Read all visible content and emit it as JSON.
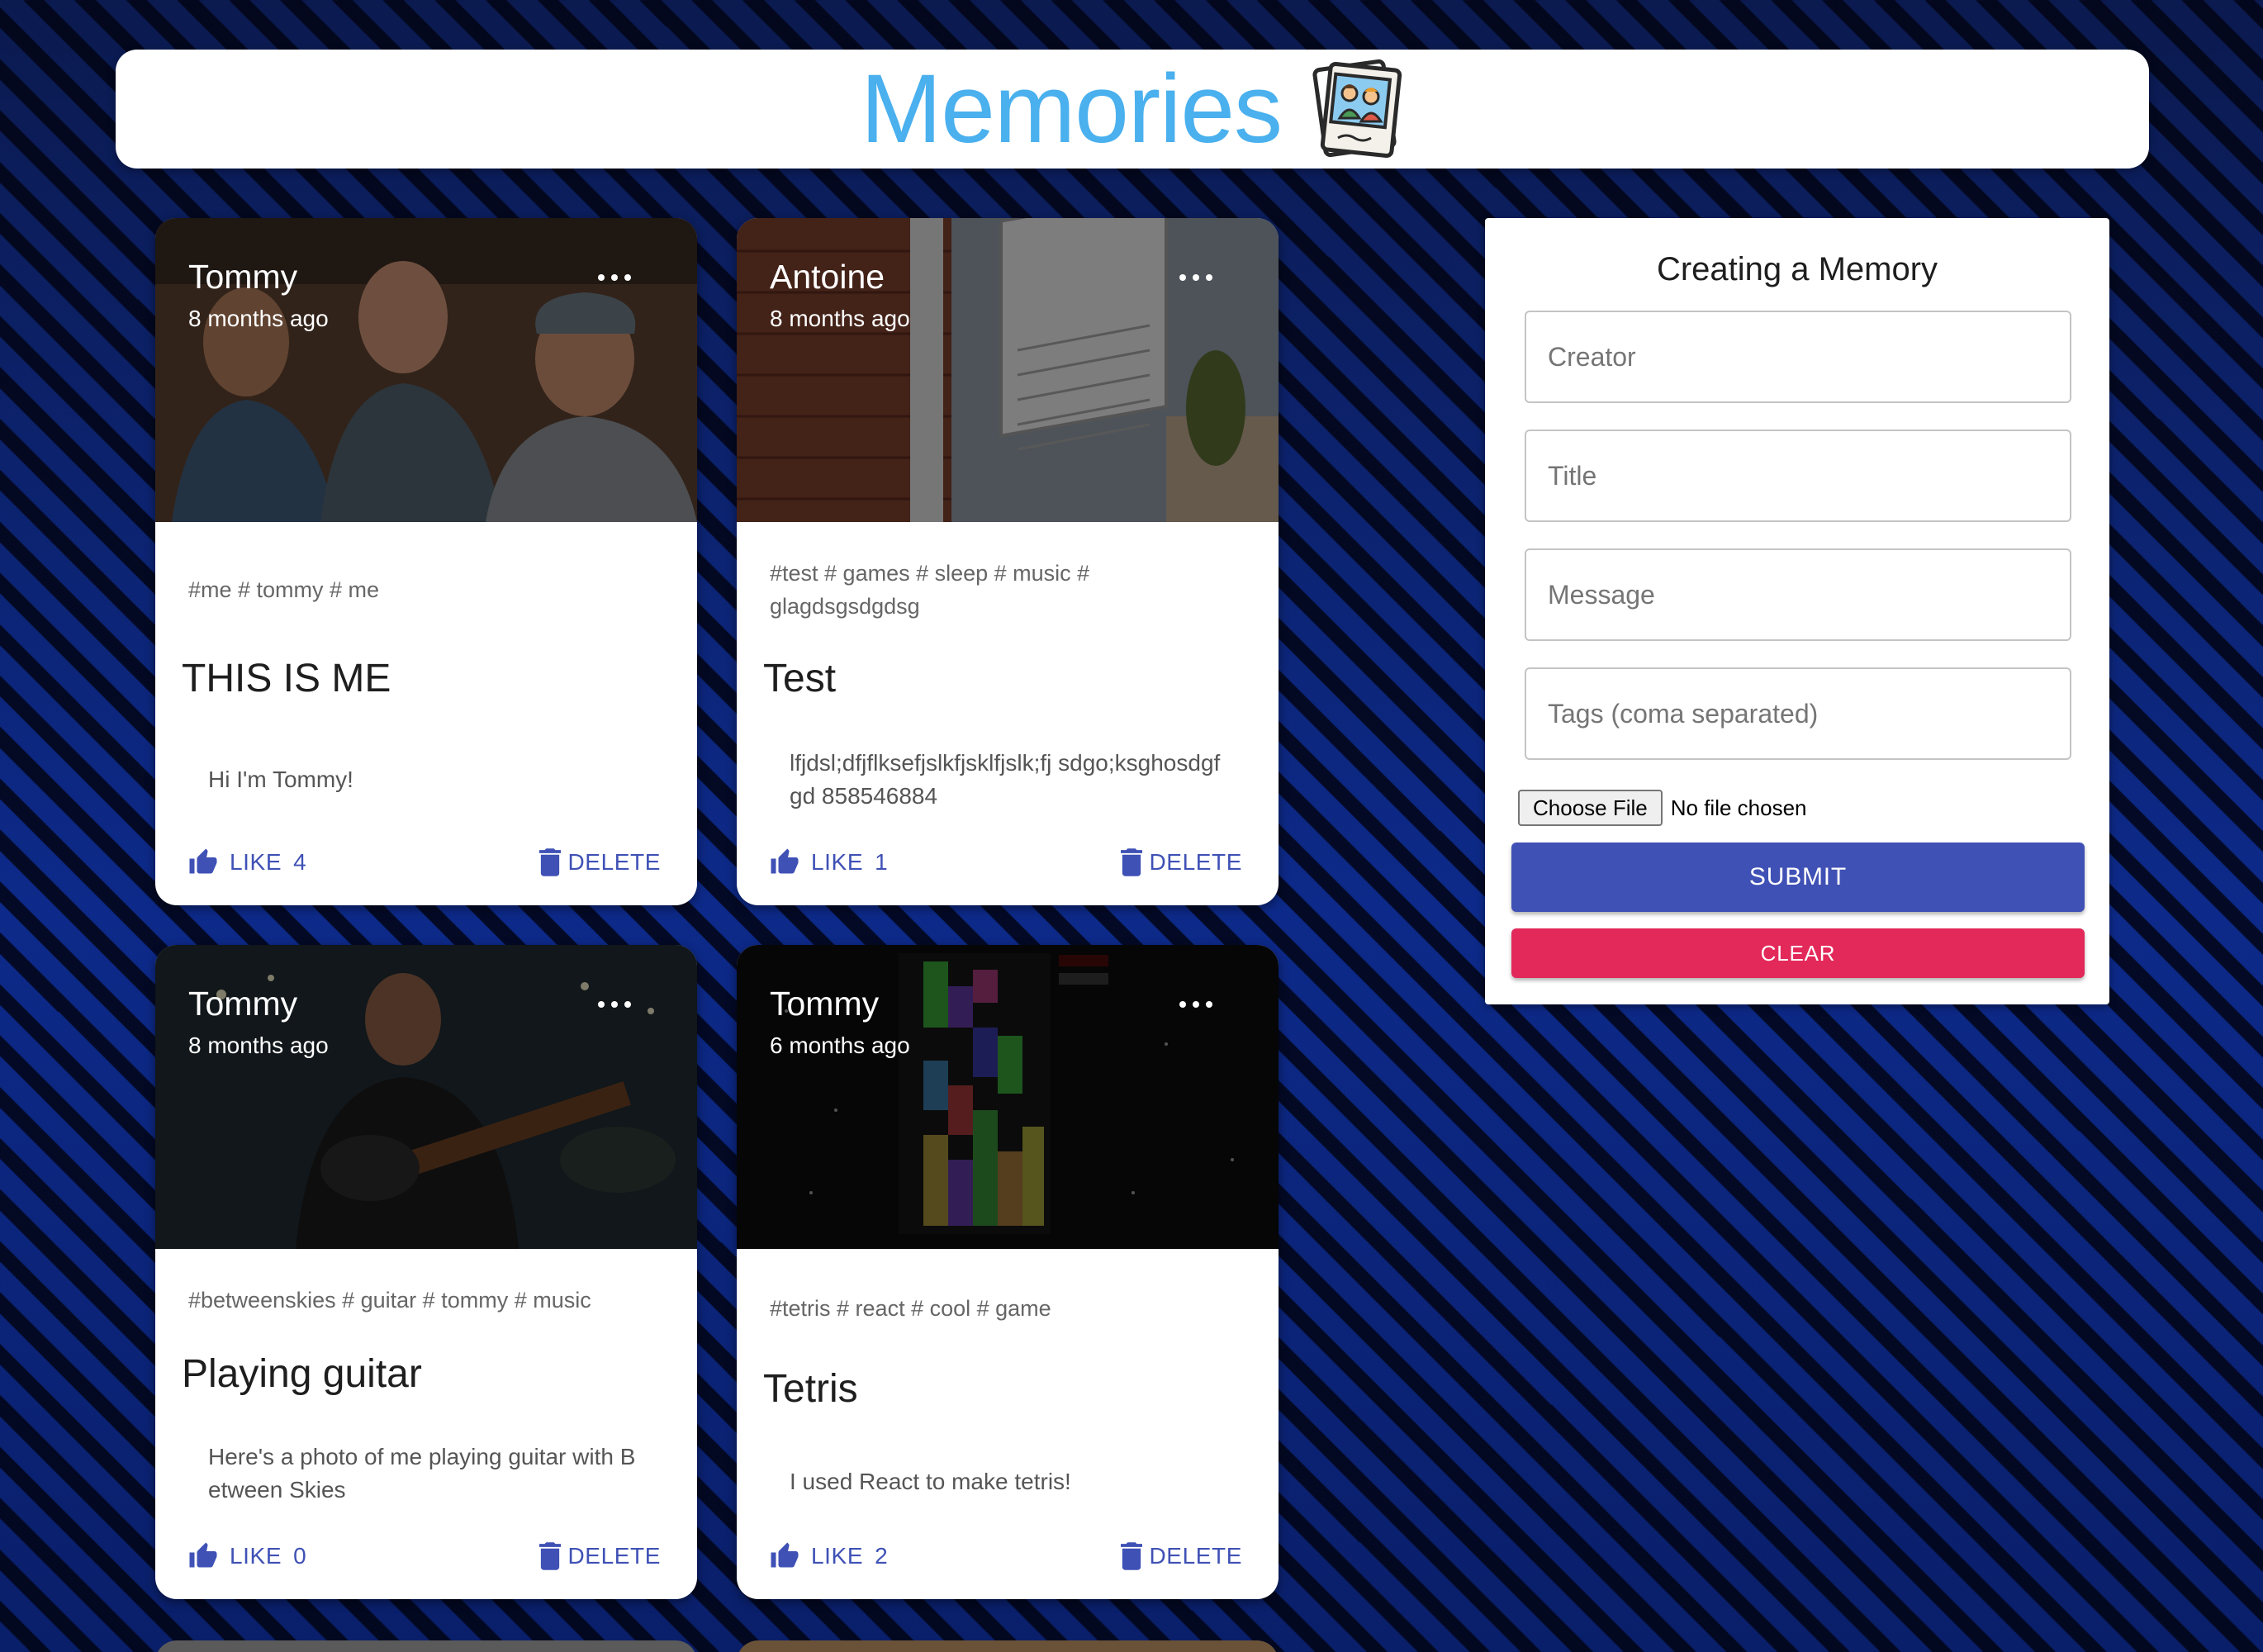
{
  "header": {
    "title": "Memories",
    "logo_icon": "photo-memories-icon"
  },
  "posts": [
    {
      "creator": "Tommy",
      "time": "8 months ago",
      "tags": "#me # tommy # me",
      "title": "THIS IS ME",
      "message": "Hi I'm Tommy!",
      "like_label": "LIKE",
      "like_count": "4",
      "delete_label": "DELETE"
    },
    {
      "creator": "Antoine",
      "time": "8 months ago",
      "tags": "#test # games # sleep # music # glagdsgsdgdsg",
      "title": "Test",
      "message": "lfjdsl;dfjflksefjslkfjsklfjslk;fj sdgo;ksghosdgfgd 858546884",
      "like_label": "LIKE",
      "like_count": "1",
      "delete_label": "DELETE"
    },
    {
      "creator": "Tommy",
      "time": "8 months ago",
      "tags": "#betweenskies # guitar # tommy # music",
      "title": "Playing guitar",
      "message": "Here's a photo of me playing guitar with Between Skies",
      "like_label": "LIKE",
      "like_count": "0",
      "delete_label": "DELETE"
    },
    {
      "creator": "Tommy",
      "time": "6 months ago",
      "tags": "#tetris # react # cool # game",
      "title": "Tetris",
      "message": "I used React to make tetris!",
      "like_label": "LIKE",
      "like_count": "2",
      "delete_label": "DELETE"
    }
  ],
  "form": {
    "heading": "Creating a Memory",
    "creator_placeholder": "Creator",
    "title_placeholder": "Title",
    "message_placeholder": "Message",
    "tags_placeholder": "Tags (coma separated)",
    "file_button": "Choose File",
    "file_status": "No file chosen",
    "submit_label": "SUBMIT",
    "clear_label": "CLEAR"
  },
  "colors": {
    "primary": "#3f51b5",
    "secondary": "#e3285a",
    "title": "#4ab0ee"
  }
}
